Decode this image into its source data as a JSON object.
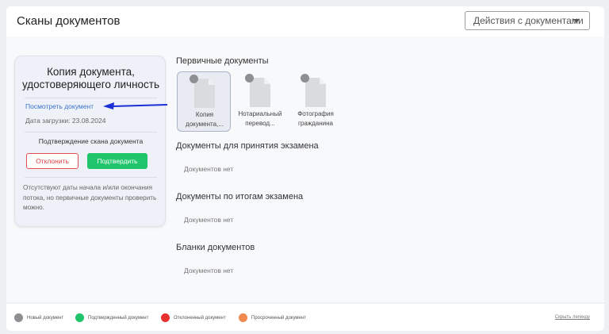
{
  "header": {
    "title": "Сканы документов",
    "actions_label": "Действия с документами"
  },
  "card": {
    "title": "Копия документа, удостоверяющего личность",
    "view_link": "Посмотреть документ",
    "upload_date": "Дата загрузки: 23.08.2024",
    "confirm_title": "Подтверждение скана документа",
    "reject_label": "Отклонить",
    "confirm_label": "Подтвердить",
    "note": "Отсутствуют даты начала и/или окончания потока, но первичные документы проверить можно."
  },
  "sections": {
    "primary": {
      "title": "Первичные документы",
      "docs": [
        {
          "label": "Копия документа,...",
          "status": "new",
          "selected": true
        },
        {
          "label": "Нотариальный перевод...",
          "status": "new",
          "selected": false
        },
        {
          "label": "Фотография гражданина",
          "status": "new",
          "selected": false
        }
      ]
    },
    "exam_admission": {
      "title": "Документы для принятия экзамена",
      "empty": "Документов нет"
    },
    "exam_results": {
      "title": "Документы по итогам экзамена",
      "empty": "Документов нет"
    },
    "blanks": {
      "title": "Бланки документов",
      "empty": "Документов нет"
    }
  },
  "legend": {
    "items": [
      {
        "label": "Новый документ",
        "color": "#8d8f92"
      },
      {
        "label": "Подтвержденный документ",
        "color": "#1fc46b"
      },
      {
        "label": "Отклоненный документ",
        "color": "#e8312f"
      },
      {
        "label": "Просроченный документ",
        "color": "#f0894f"
      }
    ],
    "hide_label": "Скрыть легенду"
  },
  "colors": {
    "accent_link": "#3a73c9",
    "annotation_arrow": "#1a2fd6"
  }
}
